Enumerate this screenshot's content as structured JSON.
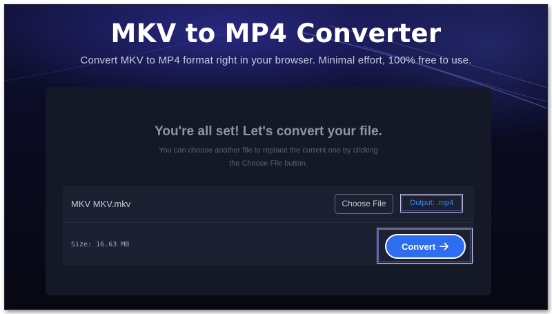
{
  "hero": {
    "title": "MKV to MP4 Converter",
    "subtitle": "Convert MKV to MP4 format right in your browser. Minimal effort, 100% free to use."
  },
  "card": {
    "heading": "You're all set! Let's convert your file.",
    "description": "You can choose another file to replace the current one by clicking the Choose File button."
  },
  "file": {
    "name": "MKV MKV.mkv",
    "size": "Size: 16.63 MB"
  },
  "actions": {
    "choose_label": "Choose File",
    "output_label": "Output: .mp4",
    "convert_label": "Convert",
    "convert_icon": "arrow-right-icon"
  },
  "colors": {
    "accent": "#2e6cf0",
    "output_link": "#3d86f2",
    "background": "#0a0b22"
  }
}
